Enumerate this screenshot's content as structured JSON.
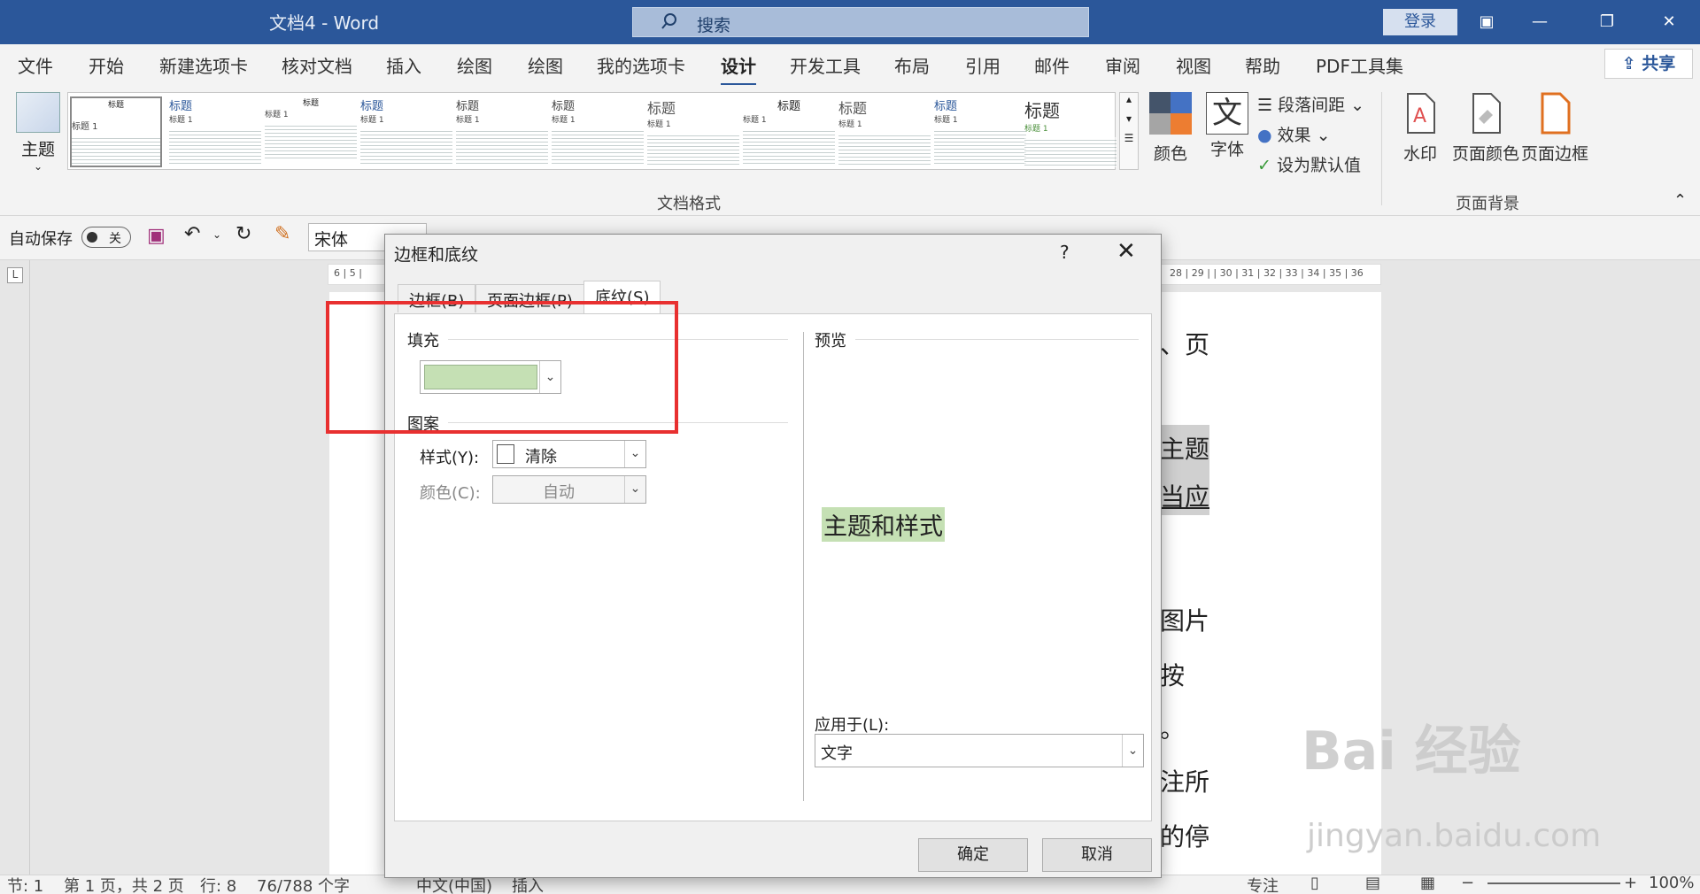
{
  "titlebar": {
    "title": "文档4  -  Word",
    "search_placeholder": "搜索",
    "login": "登录"
  },
  "tabs": [
    {
      "label": "文件",
      "active": false
    },
    {
      "label": "开始",
      "active": false
    },
    {
      "label": "新建选项卡",
      "active": false
    },
    {
      "label": "核对文档",
      "active": false
    },
    {
      "label": "插入",
      "active": false
    },
    {
      "label": "绘图",
      "active": false
    },
    {
      "label": "绘图",
      "active": false
    },
    {
      "label": "我的选项卡",
      "active": false
    },
    {
      "label": "设计",
      "active": true
    },
    {
      "label": "开发工具",
      "active": false
    },
    {
      "label": "布局",
      "active": false
    },
    {
      "label": "引用",
      "active": false
    },
    {
      "label": "邮件",
      "active": false
    },
    {
      "label": "审阅",
      "active": false
    },
    {
      "label": "视图",
      "active": false
    },
    {
      "label": "帮助",
      "active": false
    },
    {
      "label": "PDF工具集",
      "active": false
    }
  ],
  "share": "共享",
  "ribbon": {
    "theme": "主题",
    "gallery_heading": "标题",
    "gallery_subheading": "标题 1",
    "group_doc_format": "文档格式",
    "colors": "颜色",
    "fonts": "字体",
    "paragraph_spacing": "段落间距",
    "effects": "效果",
    "set_default": "设为默认值",
    "watermark": "水印",
    "page_color": "页面颜色",
    "page_borders": "页面边框",
    "group_page_bg": "页面背景"
  },
  "qat": {
    "autosave": "自动保存",
    "toggle": "关",
    "font": "宋体"
  },
  "page_text": [
    "、页",
    "主题",
    "当应",
    "图片",
    "按",
    "。",
    "注所",
    "的停"
  ],
  "hruler_ticks": "28 | 29 |   | 30 | 31 | 32 | 33 | 34 | 35 | 36",
  "hruler_left": "6  |  5  |",
  "status": {
    "section": "节: 1",
    "page": "第 1 页，共 2 页",
    "line": "行: 8",
    "words": "76/788 个字",
    "lang": "中文(中国)",
    "mode": "插入",
    "focus": "专注",
    "zoom": "100%"
  },
  "dialog": {
    "title": "边框和底纹",
    "help": "?",
    "tabs": [
      "边框(B)",
      "页面边框(P)",
      "底纹(S)"
    ],
    "active_tab": 2,
    "fill_label": "填充",
    "fill_color": "#c5e0b4",
    "pattern_label": "图案",
    "style_label": "样式(Y):",
    "style_value": "清除",
    "color_label": "颜色(C):",
    "color_value": "自动",
    "preview_label": "预览",
    "preview_text": "主题和样式",
    "apply_label": "应用于(L):",
    "apply_value": "文字",
    "ok": "确定",
    "cancel": "取消"
  },
  "watermark": {
    "brand": "Bai  经验",
    "url": "jingyan.baidu.com"
  }
}
